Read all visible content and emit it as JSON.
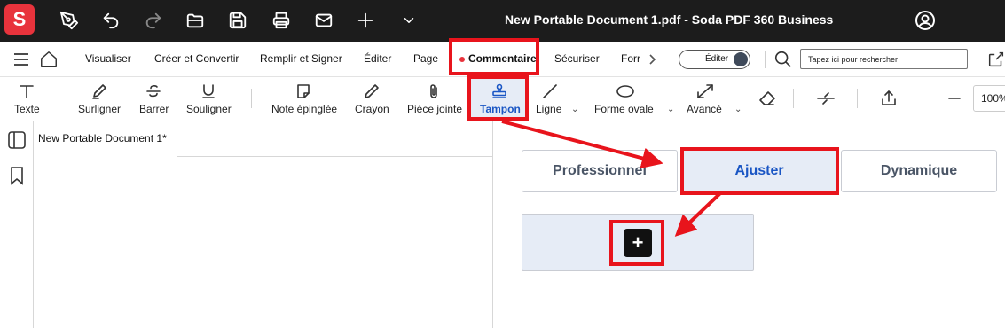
{
  "app": {
    "logo_letter": "S",
    "title": "New Portable Document 1.pdf  -  Soda PDF 360 Business",
    "brand_color": "#e8333c"
  },
  "titlebar_icons": [
    "pen-icon",
    "undo-icon",
    "redo-icon",
    "open-folder-icon",
    "save-icon",
    "print-icon",
    "mail-icon",
    "plus-icon",
    "chevron-down-icon",
    "account-icon"
  ],
  "menu": {
    "items": [
      "Visualiser",
      "Créer et Convertir",
      "Remplir et Signer",
      "Éditer",
      "Page",
      "Commentaire",
      "Sécuriser",
      "Forr"
    ],
    "active": "Commentaire",
    "toggle_label": "Éditer",
    "search_placeholder": "Tapez ici pour rechercher"
  },
  "toolbar": {
    "tools": {
      "texte": "Texte",
      "surligner": "Surligner",
      "barrer": "Barrer",
      "souligner": "Souligner",
      "note": "Note épinglée",
      "crayon": "Crayon",
      "piece": "Pièce jointe",
      "tampon": "Tampon",
      "ligne": "Ligne",
      "forme": "Forme ovale",
      "avance": "Avancé"
    },
    "active": "Tampon",
    "zoom": "100%"
  },
  "document": {
    "tab_title": "New Portable Document 1*"
  },
  "stamp_panel": {
    "tabs": [
      "Professionnel",
      "Ajuster",
      "Dynamique"
    ],
    "active_tab": "Ajuster",
    "add_symbol": "+"
  },
  "colors": {
    "accent": "#1a56c4",
    "annotation_red": "#e8141c",
    "active_bg": "#e6ecf6"
  }
}
